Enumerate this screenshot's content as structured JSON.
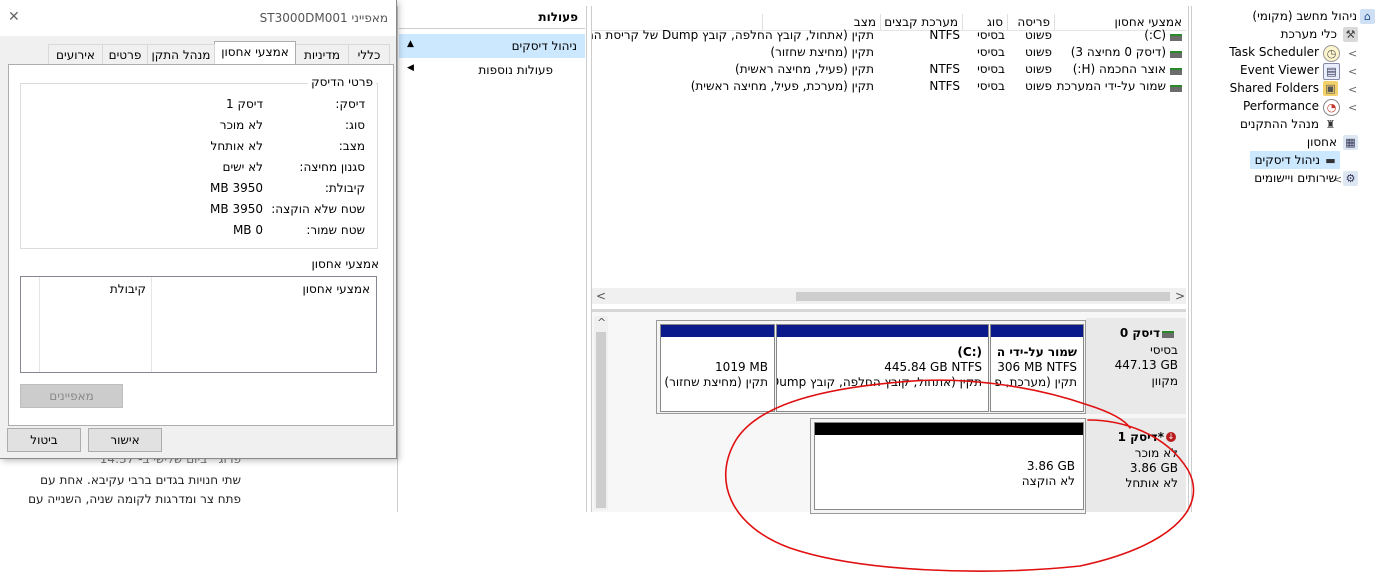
{
  "background_article": {
    "headline_snippet": "...",
    "line1": "פרוג ‧ ביום שלישי ב- 14:37",
    "line2": "שתי חנויות בגדים ברבי עקיבא. אחת עם",
    "line3": "פתח צר ומדרגות לקומה שניה, השנייה עם"
  },
  "dialog": {
    "title": "מאפייני ST3000DM001",
    "close_glyph": "✕",
    "tabs": [
      "כללי",
      "מדיניות",
      "אמצעי אחסון",
      "מנהל התקן",
      "פרטים",
      "אירועים"
    ],
    "active_tab": "אמצעי אחסון",
    "disk_info_title": "פרטי הדיסק",
    "disk_info": [
      {
        "label": "דיסק:",
        "value": "דיסק 1"
      },
      {
        "label": "סוג:",
        "value": "לא מוכר"
      },
      {
        "label": "מצב:",
        "value": "לא אותחל"
      },
      {
        "label": "סגנון מחיצה:",
        "value": "לא ישים"
      },
      {
        "label": "קיבולת:",
        "value": "3950 MB"
      },
      {
        "label": "שטח שלא הוקצה:",
        "value": "3950 MB"
      },
      {
        "label": "שטח שמור:",
        "value": "0 MB"
      }
    ],
    "volumes_title": "אמצעי אחסון",
    "volumes_columns": [
      "אמצעי אחסון",
      "קיבולת"
    ],
    "properties_button": "מאפיינים",
    "ok_button": "אישור",
    "cancel_button": "ביטול"
  },
  "actions": {
    "header": "פעולות",
    "section": "ניהול דיסקים",
    "more": "פעולות נוספות",
    "section_arrow": "▲",
    "more_arrow": "◀"
  },
  "volume_list": {
    "columns": [
      "אמצעי אחסון",
      "פריסה",
      "סוג",
      "מערכת קבצים",
      "מצב"
    ],
    "rows": [
      {
        "volume": "(C:)",
        "layout": "פשוט",
        "type": "בסיסי",
        "fs": "NTFS",
        "status": "תקין (אתחול, קובץ החלפה, קובץ Dump של קריסת המ"
      },
      {
        "volume": "(דיסק 0 מחיצה 3)",
        "layout": "פשוט",
        "type": "בסיסי",
        "fs": "",
        "status": "תקין (מחיצת שחזור)"
      },
      {
        "volume": "אוצר החכמה (H:)",
        "layout": "פשוט",
        "type": "בסיסי",
        "fs": "NTFS",
        "status": "תקין (פעיל, מחיצה ראשית)"
      },
      {
        "volume": "שמור על-ידי המערכת",
        "layout": "פשוט",
        "type": "בסיסי",
        "fs": "NTFS",
        "status": "תקין (מערכת, פעיל, מחיצה ראשית)"
      }
    ],
    "scroll_left": "<",
    "scroll_right": ">"
  },
  "disk_map": {
    "disk0": {
      "name": "דיסק 0",
      "type": "בסיסי",
      "size": "447.13 GB",
      "status": "מקוון",
      "partitions": [
        {
          "title": "שמור על-ידי ה",
          "size": "306 MB NTFS",
          "status": "תקין (מערכת, פ"
        },
        {
          "title": "(C:)",
          "size": "445.84 GB NTFS",
          "status": "תקין (אתחול, קובץ החלפה, קובץ Dump"
        },
        {
          "title": "",
          "size": "1019 MB",
          "status": "תקין (מחיצת שחזור)"
        }
      ]
    },
    "disk1": {
      "name": "*דיסק 1",
      "type": "לא מוכר",
      "size": "3.86 GB",
      "status": "לא אותחל",
      "unallocated_size": "3.86 GB",
      "unallocated_label": "לא הוקצה"
    },
    "scroll_up": "^"
  },
  "tree": {
    "items": [
      {
        "label": "ניהול מחשב (מקומי)",
        "icon": "computer-management-icon",
        "level": 0
      },
      {
        "label": "כלי מערכת",
        "icon": "system-tools-icon",
        "level": 1
      },
      {
        "label": "Task Scheduler",
        "icon": "clock-icon",
        "level": 2
      },
      {
        "label": "Event Viewer",
        "icon": "event-viewer-icon",
        "level": 2
      },
      {
        "label": "Shared Folders",
        "icon": "shared-folders-icon",
        "level": 2
      },
      {
        "label": "Performance",
        "icon": "performance-icon",
        "level": 2
      },
      {
        "label": "מנהל ההתקנים",
        "icon": "device-manager-icon",
        "level": 2
      },
      {
        "label": "אחסון",
        "icon": "storage-icon",
        "level": 1
      },
      {
        "label": "ניהול דיסקים",
        "icon": "disk-management-icon",
        "level": 2
      },
      {
        "label": "שירותים ויישומים",
        "icon": "services-icon",
        "level": 1
      }
    ]
  },
  "colors": {
    "partition_header": "#0b1a8a",
    "unallocated_header": "#000000",
    "annotation": "#e01010",
    "selection": "#cce8ff"
  }
}
